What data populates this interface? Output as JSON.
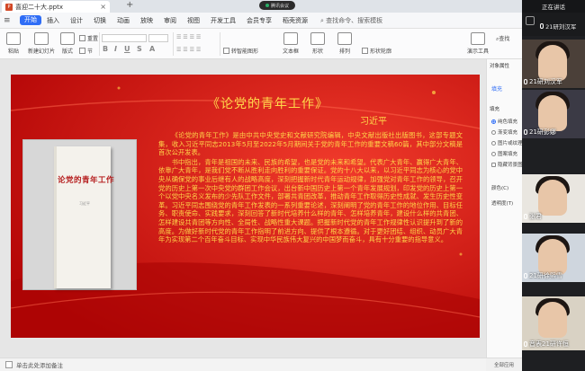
{
  "window": {
    "doc_tab_label": "喜迎二十大.pptx",
    "doc_tab_badge": "P",
    "new_tab": "+",
    "meeting_pill": "腾讯会议"
  },
  "menu": {
    "start": "开始",
    "items": [
      "插入",
      "设计",
      "切换",
      "动画",
      "放映",
      "审阅",
      "视图",
      "开发工具",
      "会员专享",
      "稻壳资源"
    ],
    "search": "查找命令、搜索模板"
  },
  "ribbon": {
    "paste": "粘贴",
    "new_slide": "新建幻灯片",
    "layout": "版式",
    "section": "节",
    "reset": "重置",
    "find": "查找",
    "text_box": "文本框",
    "shape": "形状",
    "arrange": "排列",
    "shape_outline": "形状轮廓",
    "convert_smartart": "转智能图形",
    "slideshow": "演示工具"
  },
  "slide": {
    "title": "《论党的青年工作》",
    "author": "习近平",
    "paragraphs": [
      "《论党的青年工作》是由中共中央党史和文献研究院编辑，中央文献出版社出版图书，这部专题文集，收入习近平同志2013年5月至2022年5月期间关于党的青年工作的重要文稿60篇，其中部分文稿是首次公开发表。",
      "书中指出，青年是祖国的未来、民族的希望，也是党的未来和希望。代表广大青年、赢得广大青年、依靠广大青年，是我们党不断从胜利走向胜利的重要保证。党的十八大以来，以习近平同志为核心的党中央从确保党的事业后继有人的战略高度，深刻把握新时代青年运动规律，加强党对青年工作的领导，召开党的历史上第一次中央党的群团工作会议，出台新中国历史上第一个青年发展规划，印发党的历史上第一个以党中央名义发布的少先队工作文件，部署共青团改革，推动青年工作取得历史性成就、发生历史性变革。习近平同志围绕党的青年工作发表的一系列重要论述，深刻阐明了党的青年工作的地位作用、目标任务、职责使命、实践要求，深刻回答了新时代培养什么样的青年、怎样培养青年，建设什么样的共青团、怎样建设共青团等方向性、全局性、战略性重大课题。把握新时代党的青年工作规律性认识提升到了新的高度。为做好新时代党的青年工作指明了前进方向、提供了根本遵循。对于更好团结、组织、动员广大青年为实现第二个百年奋斗目标、实现中华民族伟大复兴的中国梦而奋斗，具有十分重要的指导意义。"
    ],
    "book_title": "论党的青年工作",
    "book_author": "习近平"
  },
  "status": {
    "notes_hint": "单击此处添加备注"
  },
  "properties": {
    "title": "对象属性",
    "tab_fill": "填充",
    "section_fill": "填充",
    "options": [
      {
        "label": "纯色填充",
        "selected": true
      },
      {
        "label": "渐变填充",
        "selected": false
      },
      {
        "label": "图片或纹理填充",
        "selected": false
      },
      {
        "label": "图案填充",
        "selected": false
      },
      {
        "label": "隐藏背景图形",
        "selected": false
      }
    ],
    "color_label": "颜色(C)",
    "alpha_label": "透明度(T)",
    "footer": "全部应用"
  },
  "video": {
    "header": "正在讲话",
    "participants": [
      {
        "name": "21研刘汉军",
        "mic": true
      },
      {
        "name": "21研彭娜",
        "mic": true
      },
      {
        "name": "张君",
        "mic": true
      },
      {
        "name": "21研徐熙雪",
        "mic": true
      },
      {
        "name": "音表21研许恒",
        "mic": true
      }
    ],
    "speaking_label": "21研刘汉军"
  },
  "colors": {
    "accent": "#2f6df6",
    "slide_red": "#c80d0d",
    "slide_text": "#ffd54a"
  }
}
